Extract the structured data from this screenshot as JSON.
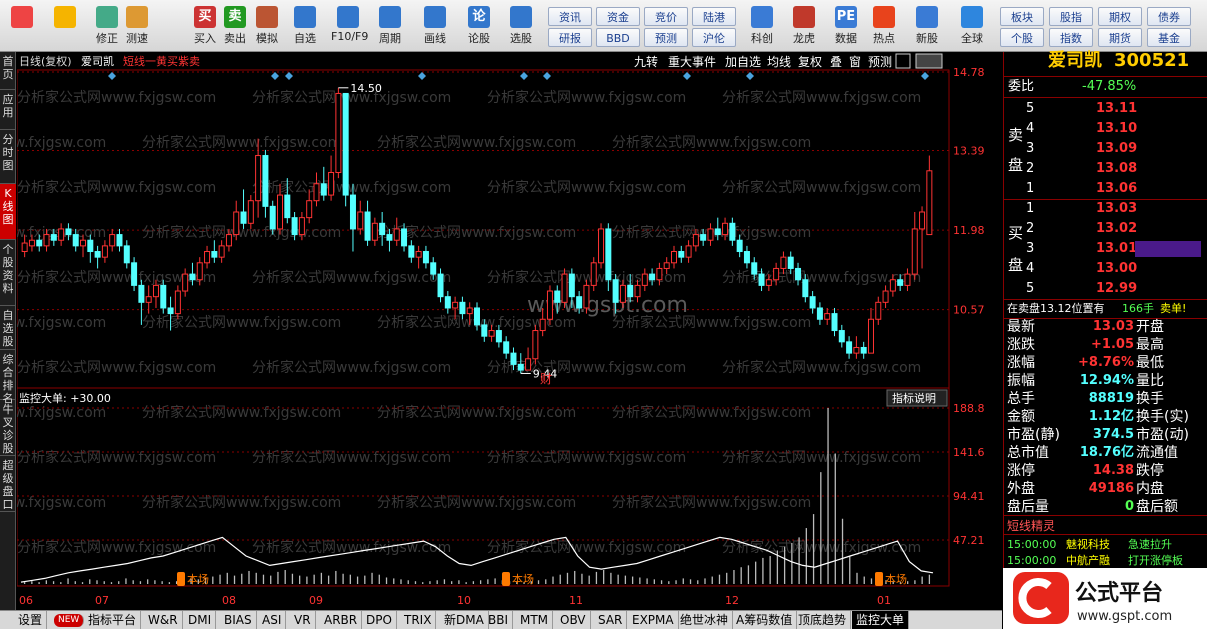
{
  "toolbar": {
    "buttons": [
      {
        "label": "",
        "icon": "grid-icon"
      },
      {
        "label": "",
        "icon": "back-arrow-icon"
      },
      {
        "label": "修正",
        "icon": "up-down-arrows-icon"
      },
      {
        "label": "测速",
        "icon": "clock-icon"
      },
      {
        "label": "买入",
        "icon": "buy-icon",
        "glyph": "买"
      },
      {
        "label": "卖出",
        "icon": "sell-icon",
        "glyph": "卖"
      },
      {
        "label": "模拟",
        "icon": "hammer-icon"
      },
      {
        "label": "自选",
        "icon": "star-icon"
      },
      {
        "label": "F10/F9",
        "icon": "f10-icon"
      },
      {
        "label": "周期",
        "icon": "period-icon"
      },
      {
        "label": "画线",
        "icon": "pencil-icon"
      },
      {
        "label": "论股",
        "icon": "discuss-icon",
        "glyph": "论"
      },
      {
        "label": "选股",
        "icon": "select-stock-icon"
      }
    ],
    "small_buttons": [
      "资讯",
      "资金",
      "竞价",
      "陆港",
      "研报",
      "BBD",
      "预测",
      "沪伦"
    ],
    "right_buttons": [
      {
        "label": "科创",
        "icon": "kechuang-icon"
      },
      {
        "label": "龙虎",
        "icon": "dragon-tiger-icon"
      },
      {
        "label": "数据",
        "icon": "pe-icon",
        "glyph": "PE"
      },
      {
        "label": "热点",
        "icon": "hot-icon"
      },
      {
        "label": "新股",
        "icon": "newstock-icon"
      },
      {
        "label": "全球",
        "icon": "globe-icon"
      }
    ],
    "far_right": [
      "板块",
      "股指",
      "期权",
      "债券",
      "个股",
      "指数",
      "期货",
      "基金"
    ]
  },
  "side_tabs": [
    "首页",
    "应用",
    "分时图",
    "K线图",
    "个股资料",
    "自选股",
    "综合排名",
    "牛叉诊股",
    "超级盘口"
  ],
  "chart": {
    "header_left": "日线(复权)",
    "stock_name": "爱司凯",
    "formula": "短线一黄买紫卖",
    "header_buttons": [
      "九转",
      "重大事件",
      "加自选",
      "均线",
      "复权",
      "叠",
      "窗",
      "预测"
    ],
    "price_ticks": [
      "14.78",
      "13.39",
      "11.98",
      "10.57"
    ],
    "high_label": "14.50",
    "low_label": "9.44",
    "cai_label": "财",
    "sub_title": "监控大单: +30.00",
    "sub_button": "指标说明",
    "sub_ticks": [
      "188.8",
      "141.6",
      "94.41",
      "47.21"
    ],
    "entry_labels": [
      "本场",
      "本场",
      "本场"
    ],
    "x_labels": [
      "06",
      "07",
      "08",
      "09",
      "10",
      "11",
      "12",
      "01"
    ],
    "watermark_site": "分析家公式网www.fxjgsw.com",
    "watermark_center": "www.gspt.com"
  },
  "chart_data": {
    "type": "candlestick",
    "title": "爱司凯 日线(复权)",
    "ylim": [
      9.2,
      14.78
    ],
    "price_high": 14.5,
    "price_low": 9.44,
    "candles": [
      [
        11.6,
        11.75,
        11.5,
        11.9
      ],
      [
        11.7,
        11.8,
        11.6,
        11.9
      ],
      [
        11.8,
        11.7,
        11.6,
        11.9
      ],
      [
        11.7,
        11.9,
        11.6,
        12.0
      ],
      [
        11.9,
        11.8,
        11.7,
        12.0
      ],
      [
        11.8,
        12.0,
        11.7,
        12.1
      ],
      [
        12.0,
        11.9,
        11.8,
        12.1
      ],
      [
        11.9,
        11.7,
        11.6,
        12.0
      ],
      [
        11.7,
        11.8,
        11.5,
        11.9
      ],
      [
        11.8,
        11.6,
        11.4,
        11.9
      ],
      [
        11.6,
        11.5,
        11.3,
        11.7
      ],
      [
        11.5,
        11.7,
        11.4,
        11.8
      ],
      [
        11.7,
        11.9,
        11.6,
        12.0
      ],
      [
        11.9,
        11.7,
        11.6,
        12.0
      ],
      [
        11.7,
        11.4,
        11.3,
        11.8
      ],
      [
        11.4,
        11.0,
        10.9,
        11.5
      ],
      [
        11.0,
        10.7,
        10.3,
        11.1
      ],
      [
        10.7,
        10.8,
        10.5,
        11.0
      ],
      [
        10.8,
        11.0,
        10.6,
        11.1
      ],
      [
        11.0,
        10.6,
        10.5,
        11.1
      ],
      [
        10.6,
        10.5,
        10.2,
        10.8
      ],
      [
        10.5,
        10.9,
        10.4,
        11.0
      ],
      [
        10.9,
        11.2,
        10.8,
        11.3
      ],
      [
        11.2,
        11.1,
        11.0,
        11.4
      ],
      [
        11.1,
        11.4,
        11.0,
        11.5
      ],
      [
        11.4,
        11.6,
        11.3,
        11.7
      ],
      [
        11.6,
        11.5,
        11.4,
        11.8
      ],
      [
        11.5,
        11.7,
        11.4,
        11.8
      ],
      [
        11.7,
        11.9,
        11.6,
        12.0
      ],
      [
        11.9,
        12.3,
        11.8,
        12.5
      ],
      [
        12.3,
        12.1,
        12.0,
        12.7
      ],
      [
        12.1,
        12.5,
        12.0,
        12.6
      ],
      [
        12.5,
        13.3,
        12.2,
        13.6
      ],
      [
        13.3,
        12.4,
        12.2,
        13.4
      ],
      [
        12.4,
        12.0,
        11.9,
        12.5
      ],
      [
        12.0,
        12.6,
        11.9,
        12.8
      ],
      [
        12.6,
        12.2,
        12.1,
        12.9
      ],
      [
        12.2,
        11.9,
        11.8,
        12.3
      ],
      [
        11.9,
        12.2,
        11.8,
        12.3
      ],
      [
        12.2,
        12.5,
        12.1,
        12.7
      ],
      [
        12.5,
        12.8,
        12.4,
        13.0
      ],
      [
        12.8,
        12.6,
        12.5,
        13.1
      ],
      [
        12.6,
        13.0,
        12.5,
        13.3
      ],
      [
        13.0,
        14.4,
        12.9,
        14.5
      ],
      [
        14.4,
        12.6,
        12.4,
        14.4
      ],
      [
        12.6,
        12.0,
        11.6,
        12.8
      ],
      [
        12.0,
        12.3,
        11.9,
        12.5
      ],
      [
        12.3,
        11.8,
        11.7,
        12.5
      ],
      [
        11.8,
        12.1,
        11.7,
        12.2
      ],
      [
        12.1,
        11.9,
        11.7,
        12.3
      ],
      [
        11.9,
        11.8,
        11.6,
        12.0
      ],
      [
        11.8,
        12.0,
        11.7,
        12.2
      ],
      [
        12.0,
        11.7,
        11.6,
        12.1
      ],
      [
        11.7,
        11.5,
        11.4,
        11.8
      ],
      [
        11.5,
        11.6,
        11.3,
        11.7
      ],
      [
        11.6,
        11.4,
        11.3,
        11.7
      ],
      [
        11.4,
        11.2,
        11.1,
        11.5
      ],
      [
        11.2,
        10.8,
        10.7,
        11.3
      ],
      [
        10.8,
        10.6,
        10.5,
        10.9
      ],
      [
        10.6,
        10.7,
        10.4,
        10.8
      ],
      [
        10.7,
        10.5,
        10.4,
        10.8
      ],
      [
        10.5,
        10.6,
        10.3,
        10.7
      ],
      [
        10.6,
        10.3,
        10.2,
        10.7
      ],
      [
        10.3,
        10.1,
        10.0,
        10.4
      ],
      [
        10.1,
        10.2,
        10.0,
        10.3
      ],
      [
        10.2,
        10.0,
        9.9,
        10.3
      ],
      [
        10.0,
        9.8,
        9.7,
        10.1
      ],
      [
        9.8,
        9.6,
        9.5,
        9.9
      ],
      [
        9.6,
        9.5,
        9.44,
        9.8
      ],
      [
        9.5,
        9.7,
        9.5,
        9.9
      ],
      [
        9.7,
        10.2,
        9.6,
        10.3
      ],
      [
        10.2,
        10.4,
        10.1,
        10.6
      ],
      [
        10.4,
        10.9,
        10.3,
        11.0
      ],
      [
        10.9,
        10.7,
        10.5,
        11.0
      ],
      [
        10.7,
        11.2,
        10.6,
        11.3
      ],
      [
        11.2,
        10.8,
        10.6,
        11.3
      ],
      [
        10.8,
        10.6,
        10.5,
        10.9
      ],
      [
        10.6,
        11.0,
        10.5,
        11.1
      ],
      [
        11.0,
        11.4,
        10.9,
        11.5
      ],
      [
        11.4,
        12.0,
        11.3,
        12.1
      ],
      [
        12.0,
        11.1,
        10.9,
        12.1
      ],
      [
        11.1,
        10.7,
        10.5,
        11.2
      ],
      [
        10.7,
        11.0,
        10.6,
        11.1
      ],
      [
        11.0,
        10.8,
        10.7,
        11.2
      ],
      [
        10.8,
        11.0,
        10.7,
        11.1
      ],
      [
        11.0,
        11.2,
        10.9,
        11.3
      ],
      [
        11.2,
        11.1,
        11.0,
        11.3
      ],
      [
        11.1,
        11.3,
        11.0,
        11.4
      ],
      [
        11.3,
        11.4,
        11.2,
        11.5
      ],
      [
        11.4,
        11.6,
        11.3,
        11.7
      ],
      [
        11.6,
        11.5,
        11.4,
        11.7
      ],
      [
        11.5,
        11.7,
        11.4,
        11.8
      ],
      [
        11.7,
        11.9,
        11.6,
        12.0
      ],
      [
        11.9,
        11.8,
        11.7,
        12.0
      ],
      [
        11.8,
        12.0,
        11.7,
        12.1
      ],
      [
        12.0,
        11.9,
        11.8,
        12.2
      ],
      [
        11.9,
        12.1,
        11.8,
        12.2
      ],
      [
        12.1,
        11.8,
        11.7,
        12.2
      ],
      [
        11.8,
        11.6,
        11.5,
        11.9
      ],
      [
        11.6,
        11.4,
        11.3,
        11.7
      ],
      [
        11.4,
        11.2,
        11.1,
        11.5
      ],
      [
        11.2,
        11.0,
        10.9,
        11.3
      ],
      [
        11.0,
        11.1,
        10.9,
        11.2
      ],
      [
        11.1,
        11.3,
        11.0,
        11.4
      ],
      [
        11.3,
        11.5,
        11.2,
        11.6
      ],
      [
        11.5,
        11.3,
        11.2,
        11.6
      ],
      [
        11.3,
        11.1,
        11.0,
        11.4
      ],
      [
        11.1,
        10.8,
        10.7,
        11.2
      ],
      [
        10.8,
        10.6,
        10.5,
        10.9
      ],
      [
        10.6,
        10.4,
        10.3,
        10.7
      ],
      [
        10.4,
        10.5,
        10.3,
        10.6
      ],
      [
        10.5,
        10.2,
        10.1,
        10.6
      ],
      [
        10.2,
        10.0,
        9.9,
        10.3
      ],
      [
        10.0,
        9.8,
        9.7,
        10.1
      ],
      [
        9.8,
        9.9,
        9.7,
        10.1
      ],
      [
        9.9,
        9.8,
        9.7,
        10.0
      ],
      [
        9.8,
        10.4,
        9.8,
        10.6
      ],
      [
        10.4,
        10.7,
        10.3,
        10.8
      ],
      [
        10.7,
        10.9,
        10.6,
        11.0
      ],
      [
        10.9,
        11.1,
        10.8,
        11.2
      ],
      [
        11.1,
        11.0,
        10.9,
        11.2
      ],
      [
        11.0,
        11.2,
        10.9,
        11.3
      ],
      [
        11.2,
        12.0,
        11.1,
        12.3
      ],
      [
        12.0,
        12.3,
        11.3,
        12.4
      ],
      [
        11.9,
        13.03,
        11.9,
        13.3
      ]
    ],
    "big_order_ylim": [
      0,
      188.8
    ],
    "big_order_bars": [
      2,
      3,
      2,
      4,
      3,
      2,
      6,
      3,
      2,
      5,
      4,
      3,
      2,
      3,
      6,
      4,
      3,
      5,
      4,
      3,
      2,
      3,
      4,
      6,
      5,
      7,
      8,
      10,
      12,
      9,
      11,
      14,
      12,
      10,
      9,
      13,
      15,
      11,
      9,
      8,
      10,
      12,
      9,
      14,
      11,
      10,
      8,
      9,
      12,
      10,
      7,
      6,
      5,
      4,
      3,
      2,
      3,
      4,
      5,
      3,
      4,
      2,
      3,
      4,
      5,
      6,
      4,
      3,
      2,
      2,
      3,
      4,
      5,
      8,
      10,
      12,
      14,
      11,
      9,
      13,
      15,
      12,
      10,
      9,
      8,
      7,
      6,
      5,
      4,
      3,
      4,
      6,
      5,
      4,
      6,
      8,
      10,
      12,
      15,
      18,
      20,
      24,
      28,
      30,
      36,
      40,
      44,
      50,
      60,
      75,
      120,
      188.8,
      140,
      70,
      30,
      12,
      8,
      6,
      5,
      4,
      3,
      2,
      3,
      4,
      8,
      10
    ],
    "big_order_line": [
      2,
      4,
      6,
      9,
      12,
      14,
      16,
      18,
      20,
      22,
      25,
      28,
      30,
      34,
      38,
      42,
      46,
      50,
      40,
      30,
      25,
      20,
      22,
      24,
      26,
      28,
      30,
      32,
      34,
      36,
      38,
      40,
      42,
      44,
      46,
      40,
      30,
      22,
      20,
      24,
      28,
      32,
      36,
      40,
      44,
      48,
      50,
      30,
      18,
      16,
      18,
      20,
      22,
      26,
      30,
      34,
      38,
      42,
      46,
      50,
      48,
      44,
      40,
      36,
      30,
      24,
      20,
      18,
      22,
      26,
      30,
      34,
      38,
      42,
      46,
      24,
      14,
      12
    ]
  },
  "quote": {
    "name": "爱司凯",
    "code": "300521",
    "weibi_label": "委比",
    "weibi_value": "-47.85%",
    "sell_label": [
      "卖",
      "盘"
    ],
    "buy_label": [
      "买",
      "盘"
    ],
    "sells": [
      [
        "5",
        "13.11"
      ],
      [
        "4",
        "13.10"
      ],
      [
        "3",
        "13.09"
      ],
      [
        "2",
        "13.08"
      ],
      [
        "1",
        "13.06"
      ]
    ],
    "buys": [
      [
        "1",
        "13.03"
      ],
      [
        "2",
        "13.02"
      ],
      [
        "3",
        "13.01"
      ],
      [
        "4",
        "13.00"
      ],
      [
        "5",
        "12.99"
      ]
    ],
    "note": "在卖盘13.12位置有",
    "note_count": "166手",
    "note_tag": "卖单!",
    "stats": [
      [
        "最新",
        "13.03",
        "开盘",
        ""
      ],
      [
        "涨跌",
        "+1.05",
        "最高",
        ""
      ],
      [
        "涨幅",
        "+8.76%",
        "最低",
        ""
      ],
      [
        "振幅",
        "12.94%",
        "量比",
        ""
      ],
      [
        "总手",
        "88819",
        "换手",
        ""
      ],
      [
        "金额",
        "1.12亿",
        "换手(实)",
        ""
      ],
      [
        "市盈(静)",
        "374.5",
        "市盈(动)",
        ""
      ],
      [
        "总市值",
        "18.76亿",
        "流通值",
        ""
      ],
      [
        "涨停",
        "14.38",
        "跌停",
        ""
      ],
      [
        "外盘",
        "49186",
        "内盘",
        ""
      ],
      [
        "盘后量",
        "0",
        "盘后额",
        ""
      ]
    ],
    "genie_title": "短线精灵",
    "genie_rows": [
      [
        "15:00:00",
        "魅视科技",
        "急速拉升"
      ],
      [
        "15:00:00",
        "中航产融",
        "打开涨停板"
      ]
    ]
  },
  "bottom_tabs": [
    "设置",
    "NEW",
    "指标平台",
    "W&R",
    "DMI",
    "BIAS",
    "ASI",
    "VR",
    "ARBR",
    "DPO",
    "TRIX",
    "新DMA",
    "BBI",
    "MTM",
    "OBV",
    "SAR",
    "EXPMA",
    "绝世冰神",
    "A筹码数值",
    "顶底趋势",
    "监控大单"
  ],
  "brand": {
    "name": "公式平台",
    "url": "www.gspt.com"
  },
  "colors": {
    "up": "#ff3333",
    "down": "#54ffff",
    "accent": "#ffff00",
    "grid": "#8a0000",
    "bg": "#000000"
  }
}
